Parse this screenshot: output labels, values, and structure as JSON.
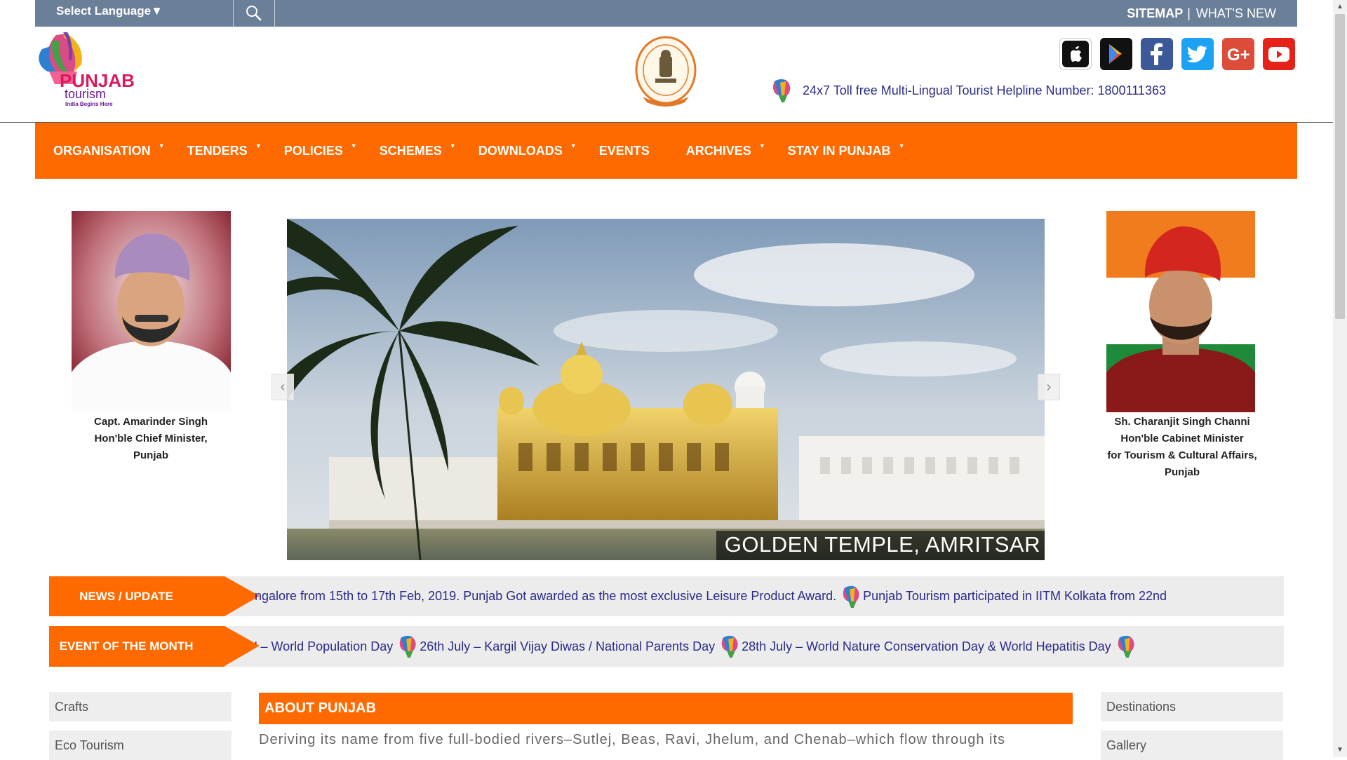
{
  "topbar": {
    "language_label": "Select Language▼",
    "sitemap": "SITEMAP",
    "separator": "|",
    "whats_new": "WHAT'S NEW"
  },
  "header": {
    "logo_text": "PUNJAB",
    "logo_sub": "tourism",
    "logo_tagline": "India Begins Here",
    "helpline": "24x7 Toll free Multi-Lingual Tourist Helpline Number: 1800111363"
  },
  "nav": {
    "items": [
      {
        "label": "ORGANISATION",
        "has_dropdown": true
      },
      {
        "label": "TENDERS",
        "has_dropdown": true
      },
      {
        "label": "POLICIES",
        "has_dropdown": true
      },
      {
        "label": "SCHEMES",
        "has_dropdown": true
      },
      {
        "label": "DOWNLOADS",
        "has_dropdown": true
      },
      {
        "label": "EVENTS",
        "has_dropdown": false
      },
      {
        "label": "ARCHIVES",
        "has_dropdown": true
      },
      {
        "label": "STAY IN PUNJAB",
        "has_dropdown": true
      }
    ]
  },
  "leaders": {
    "left": {
      "name": "Capt. Amarinder Singh",
      "title": "Hon'ble Chief Minister,",
      "place": "Punjab"
    },
    "right": {
      "name": "Sh. Charanjit Singh Channi",
      "title": "Hon'ble Cabinet Minister",
      "portfolio": "for Tourism & Cultural Affairs,",
      "place": "Punjab"
    }
  },
  "slider": {
    "caption": "GOLDEN TEMPLE, AMRITSAR"
  },
  "tickers": {
    "news_label": "NEWS / UPDATE",
    "news_text_1": "ngalore from 15th to 17th Feb, 2019. Punjab Got awarded as the most exclusive Leisure Product Award.",
    "news_text_2": "Punjab Tourism participated in IITM Kolkata from 22nd",
    "event_label": "EVENT OF THE MONTH",
    "event_text_1": "' – World Population Day",
    "event_text_2": "26th July – Kargil Vijay Diwas / National Parents Day",
    "event_text_3": "28th July – World Nature Conservation Day & World Hepatitis Day"
  },
  "left_menu": [
    "Crafts",
    "Eco Tourism"
  ],
  "right_menu": [
    "Destinations",
    "Gallery"
  ],
  "about": {
    "heading": "ABOUT PUNJAB",
    "text": "Deriving its name from five full-bodied rivers–Sutlej, Beas, Ravi, Jhelum, and Chenab–which flow through its"
  },
  "colors": {
    "accent": "#ff6a00",
    "topbar": "#6a7f98",
    "link": "#2a2a8a"
  }
}
